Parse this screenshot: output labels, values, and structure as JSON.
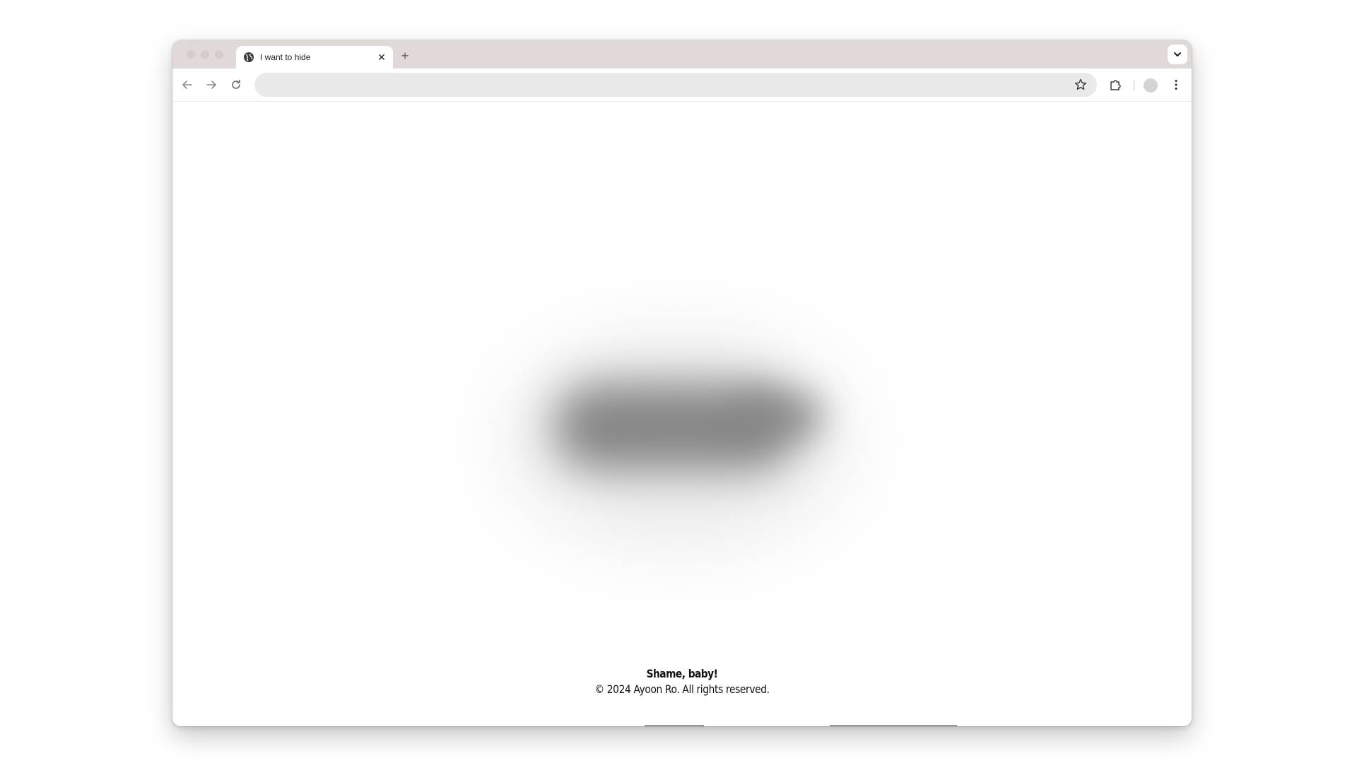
{
  "browser": {
    "tab": {
      "title": "I want to hide",
      "favicon": "globe-icon",
      "close_icon": "close-icon"
    },
    "new_tab_icon": "plus-icon",
    "tab_search_icon": "chevron-down-icon",
    "toolbar": {
      "back_icon": "arrow-left-icon",
      "forward_icon": "arrow-right-icon",
      "reload_icon": "reload-icon",
      "address": "",
      "bookmark_icon": "star-icon",
      "extensions_icon": "puzzle-icon",
      "profile_icon": "avatar-icon",
      "menu_icon": "kebab-menu-icon"
    },
    "colors": {
      "tabstrip": "#e0d9d8",
      "omnibox": "#e9e9e9"
    }
  },
  "page": {
    "footer": {
      "title": "Shame, baby!",
      "copyright": "© 2024 Ayoon Ro. All rights reserved."
    }
  }
}
